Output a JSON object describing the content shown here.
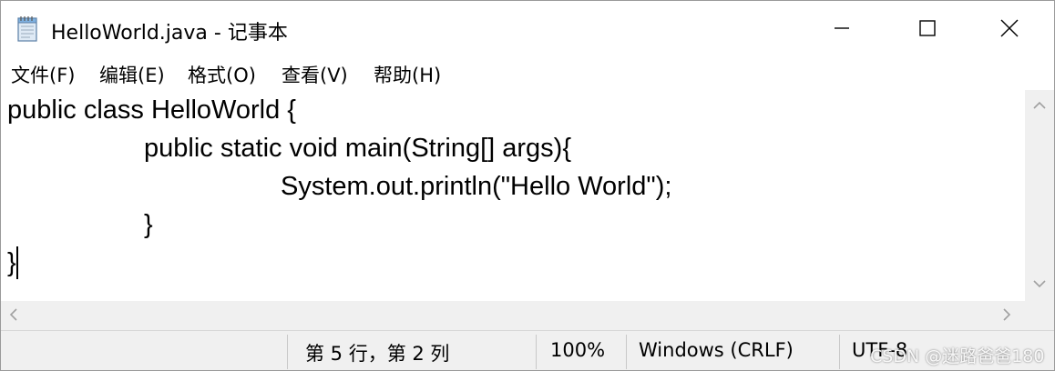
{
  "window": {
    "title": "HelloWorld.java - 记事本"
  },
  "menu": {
    "items": [
      {
        "label": "文件(F)"
      },
      {
        "label": "编辑(E)"
      },
      {
        "label": "格式(O)"
      },
      {
        "label": "查看(V)"
      },
      {
        "label": "帮助(H)"
      }
    ]
  },
  "editor": {
    "lines": [
      "public class HelloWorld {",
      "public static void main(String[] args){",
      "System.out.println(\"Hello World\");",
      "}",
      "}"
    ]
  },
  "status": {
    "position": "第 5 行，第 2 列",
    "zoom": "100%",
    "line_ending": "Windows (CRLF)",
    "encoding": "UTF-8"
  },
  "watermark": "CSDN @迷路爸爸180",
  "colors": {
    "chrome_background": "#f0f0f0",
    "text": "#000000",
    "window_border": "#9a9a9a"
  },
  "icons": {
    "app": "notepad-icon",
    "minimize": "minimize-icon",
    "maximize": "maximize-icon",
    "close": "close-icon"
  }
}
